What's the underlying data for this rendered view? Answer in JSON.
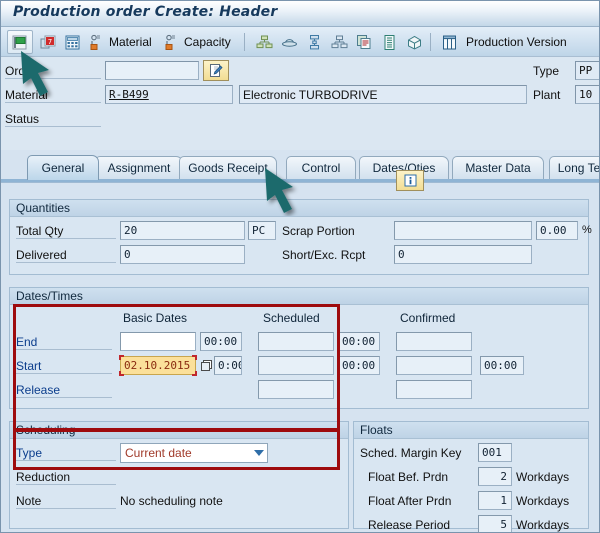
{
  "window": {
    "title": "Production order Create: Header"
  },
  "toolbar": {
    "items": [
      {
        "name": "save-green-flag",
        "icon": "green-flag-icon",
        "label": ""
      },
      {
        "name": "order-info",
        "icon": "calendar-document-icon",
        "label": ""
      },
      {
        "name": "calculator",
        "icon": "calculator-icon",
        "label": ""
      },
      {
        "name": "material-button",
        "icon": "material-icon",
        "label": "Material"
      },
      {
        "name": "capacity-button",
        "icon": "capacity-icon",
        "label": "Capacity"
      },
      {
        "name": "operation-overview",
        "icon": "hierarchy-icon",
        "label": ""
      },
      {
        "name": "components",
        "icon": "hat-icon",
        "label": ""
      },
      {
        "name": "sequence",
        "icon": "sequence-icon",
        "label": ""
      },
      {
        "name": "network",
        "icon": "network-icon",
        "label": ""
      },
      {
        "name": "documents",
        "icon": "copy-doc-icon",
        "label": ""
      },
      {
        "name": "list",
        "icon": "list-icon",
        "label": ""
      },
      {
        "name": "goods-movement",
        "icon": "box-icon",
        "label": ""
      },
      {
        "name": "table-view",
        "icon": "table-icon",
        "label": ""
      }
    ],
    "production_version_label": "Production Version"
  },
  "header_fields": {
    "order_label": "Order",
    "order_value": "",
    "order_edit_icon": "document-pencil-icon",
    "material_label": "Material",
    "material_value": "R-B499",
    "material_desc": "Electronic TURBODRIVE",
    "status_label": "Status",
    "status_info_icon": "info-icon",
    "type_label": "Type",
    "type_value": "PP",
    "plant_label": "Plant",
    "plant_value": "10"
  },
  "tabs": [
    {
      "label": "General",
      "active": true
    },
    {
      "label": "Assignment",
      "active": false
    },
    {
      "label": "Goods Receipt",
      "active": false
    },
    {
      "label": "Control",
      "active": false
    },
    {
      "label": "Dates/Qties",
      "active": false
    },
    {
      "label": "Master Data",
      "active": false
    },
    {
      "label": "Long Te",
      "active": false
    }
  ],
  "quantities": {
    "title": "Quantities",
    "total_qty_label": "Total Qty",
    "total_qty_value": "20",
    "uom_value": "PC",
    "delivered_label": "Delivered",
    "delivered_value": "0",
    "scrap_portion_label": "Scrap Portion",
    "scrap_portion_value": "",
    "scrap_pct_value": "0.00",
    "pct_sign": "%",
    "short_exc_label": "Short/Exc. Rcpt",
    "short_exc_value": "0"
  },
  "dates_times": {
    "title": "Dates/Times",
    "col_basic_dates": "Basic Dates",
    "col_scheduled": "Scheduled",
    "col_confirmed": "Confirmed",
    "rows": [
      {
        "label": "End",
        "basic_date": "",
        "basic_time": "00:00",
        "scheduled_date": "",
        "scheduled_time": "00:00",
        "confirmed_date": "",
        "confirmed_time": ""
      },
      {
        "label": "Start",
        "basic_date": "02.10.2015",
        "basic_time": "0:00",
        "scheduled_date": "",
        "scheduled_time": "00:00",
        "confirmed_date": "",
        "confirmed_time": "00:00"
      },
      {
        "label": "Release",
        "basic_date": null,
        "basic_time": null,
        "scheduled_date": "",
        "scheduled_time": null,
        "confirmed_date": "",
        "confirmed_time": null
      }
    ]
  },
  "scheduling": {
    "title": "Scheduling",
    "type_label": "Type",
    "type_value": "Current date",
    "reduction_label": "Reduction",
    "reduction_value": "",
    "note_label": "Note",
    "note_value": "No scheduling note"
  },
  "floats": {
    "title": "Floats",
    "rows": [
      {
        "label": "Sched. Margin Key",
        "value": "001",
        "unit": ""
      },
      {
        "label": "Float Bef. Prdn",
        "value": "2",
        "unit": "Workdays"
      },
      {
        "label": "Float After Prdn",
        "value": "1",
        "unit": "Workdays"
      },
      {
        "label": "Release Period",
        "value": "5",
        "unit": "Workdays"
      }
    ]
  },
  "annotations": {
    "highlight_color": "#9e0b0e",
    "arrow_color": "#1b6a6c",
    "arrow_toolbar_target": "green-flag-icon",
    "arrow_tab_target": "Goods Receipt"
  }
}
